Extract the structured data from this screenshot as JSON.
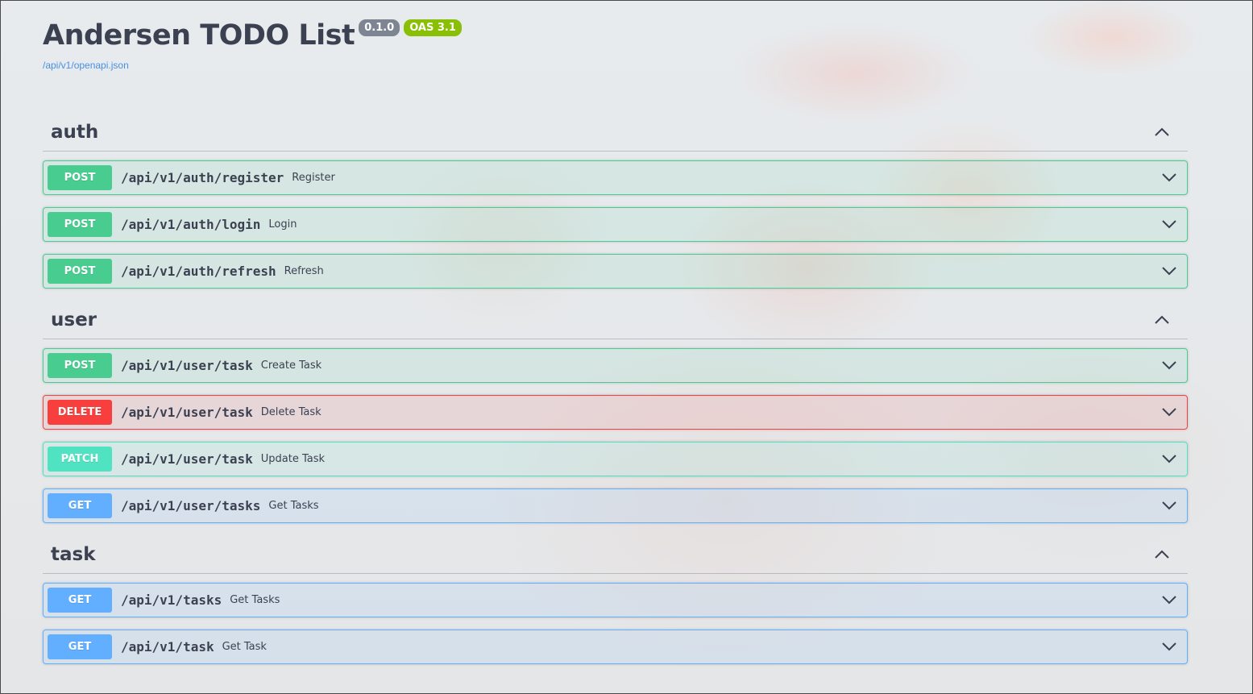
{
  "info": {
    "title": "Andersen TODO List",
    "version": "0.1.0",
    "oas_version": "OAS 3.1",
    "spec_url": "/api/v1/openapi.json"
  },
  "colors": {
    "post": "#49cc90",
    "delete": "#f93e3e",
    "patch": "#50e3c2",
    "get": "#61affe",
    "version_badge": "#7d8492",
    "oas_badge": "#89bf04",
    "link": "#4990e2"
  },
  "icons": {
    "collapse": "chevron-up-icon",
    "expand": "chevron-down-icon"
  },
  "tags": [
    {
      "name": "auth",
      "operations": [
        {
          "method": "POST",
          "path": "/api/v1/auth/register",
          "summary": "Register"
        },
        {
          "method": "POST",
          "path": "/api/v1/auth/login",
          "summary": "Login"
        },
        {
          "method": "POST",
          "path": "/api/v1/auth/refresh",
          "summary": "Refresh"
        }
      ]
    },
    {
      "name": "user",
      "operations": [
        {
          "method": "POST",
          "path": "/api/v1/user/task",
          "summary": "Create Task"
        },
        {
          "method": "DELETE",
          "path": "/api/v1/user/task",
          "summary": "Delete Task"
        },
        {
          "method": "PATCH",
          "path": "/api/v1/user/task",
          "summary": "Update Task"
        },
        {
          "method": "GET",
          "path": "/api/v1/user/tasks",
          "summary": "Get Tasks"
        }
      ]
    },
    {
      "name": "task",
      "operations": [
        {
          "method": "GET",
          "path": "/api/v1/tasks",
          "summary": "Get Tasks"
        },
        {
          "method": "GET",
          "path": "/api/v1/task",
          "summary": "Get Task"
        }
      ]
    }
  ]
}
